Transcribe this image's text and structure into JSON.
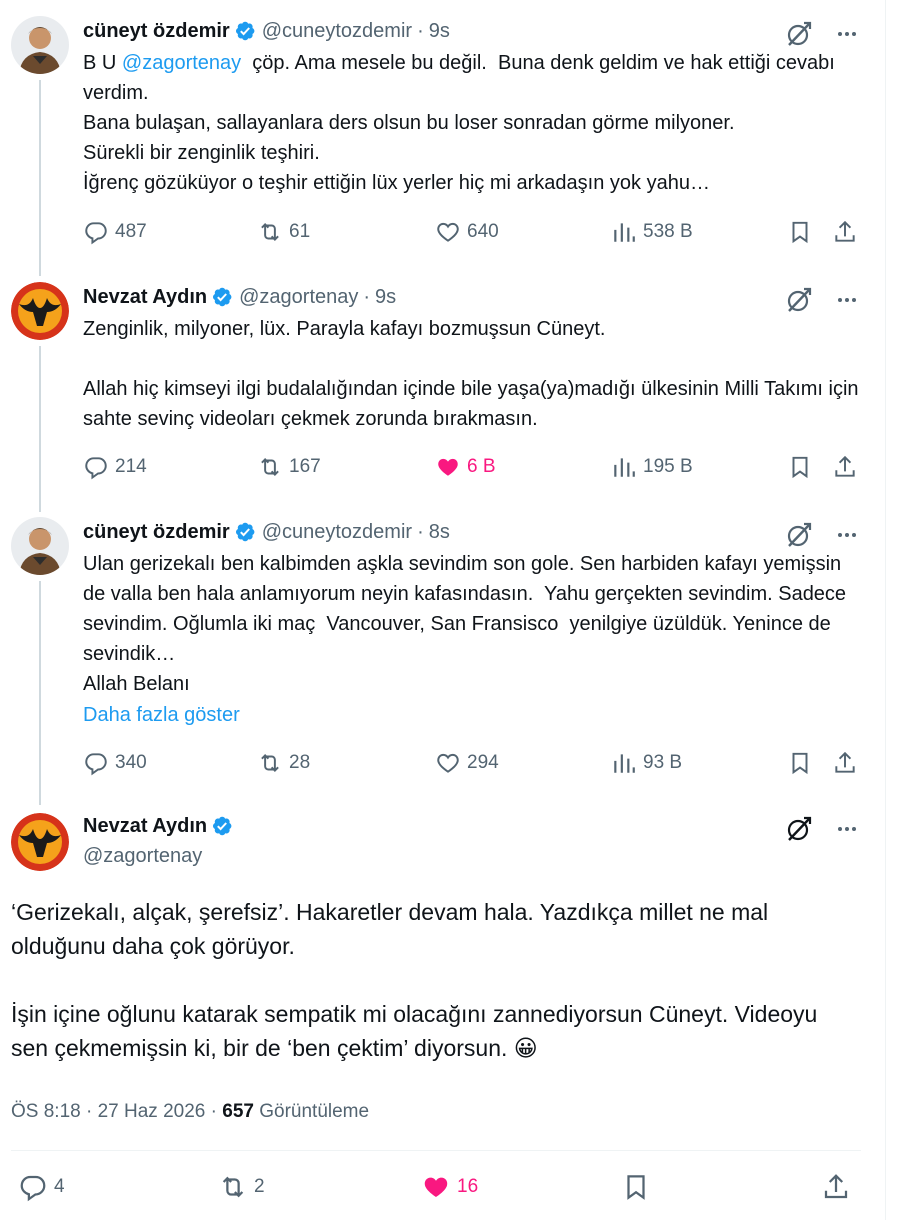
{
  "colors": {
    "accent": "#1d9bf0",
    "like": "#f91880",
    "muted": "#536471",
    "text": "#0f1419",
    "verified": "#1d9bf0"
  },
  "tweets": [
    {
      "name": "cüneyt özdemir",
      "handle": "@cuneytozdemir",
      "time": "9s",
      "text_pre": "B U ",
      "mention": "@zagortenay",
      "text_post": "  çöp. Ama mesele bu değil.  Buna denk geldim ve hak ettiği cevabı verdim.\nBana bulaşan, sallayanlara ders olsun bu loser sonradan görme milyoner.\nSürekli bir zenginlik teşhiri.\nİğrenç gözüküyor o teşhir ettiğin lüx yerler hiç mi arkadaşın yok yahu…",
      "replies": "487",
      "reposts": "61",
      "likes": "640",
      "views": "538 B"
    },
    {
      "name": "Nevzat Aydın",
      "handle": "@zagortenay",
      "time": "9s",
      "text": "Zenginlik, milyoner, lüx. Parayla kafayı bozmuşsun Cüneyt.\n\nAllah hiç kimseyi ilgi budalalığından içinde bile yaşa(ya)madığı ülkesinin Milli Takımı için sahte sevinç videoları çekmek zorunda bırakmasın.",
      "replies": "214",
      "reposts": "167",
      "likes": "6 B",
      "views": "195 B"
    },
    {
      "name": "cüneyt özdemir",
      "handle": "@cuneytozdemir",
      "time": "8s",
      "text": "Ulan gerizekalı ben kalbimden aşkla sevindim son gole. Sen harbiden kafayı yemişsin de valla ben hala anlamıyorum neyin kafasındasın.  Yahu gerçekten sevindim. Sadece sevindim. Oğlumla iki maç  Vancouver, San Fransisco  yenilgiye üzüldük. Yenince de sevindik…\nAllah Belanı",
      "show_more": "Daha fazla göster",
      "replies": "340",
      "reposts": "28",
      "likes": "294",
      "views": "93 B"
    }
  ],
  "main_tweet": {
    "name": "Nevzat Aydın",
    "handle": "@zagortenay",
    "text": "‘Gerizekalı, alçak, şerefsiz’. Hakaretler devam hala. Yazdıkça millet ne mal olduğunu daha çok görüyor.\n\nİşin içine oğlunu katarak sempatik mi olacağını zannediyorsun Cüneyt. Videoyu sen çekmemişsin ki, bir de ‘ben çektim’ diyorsun. 😀",
    "time": "ÖS 8:18",
    "date": "27 Haz 2026",
    "views_count": "657",
    "views_label": "Görüntüleme",
    "replies": "4",
    "reposts": "2",
    "likes": "16"
  },
  "icons": [
    "verified-icon",
    "grok-icon",
    "more-icon",
    "reply-icon",
    "repost-icon",
    "like-icon",
    "views-icon",
    "bookmark-icon",
    "share-icon"
  ]
}
